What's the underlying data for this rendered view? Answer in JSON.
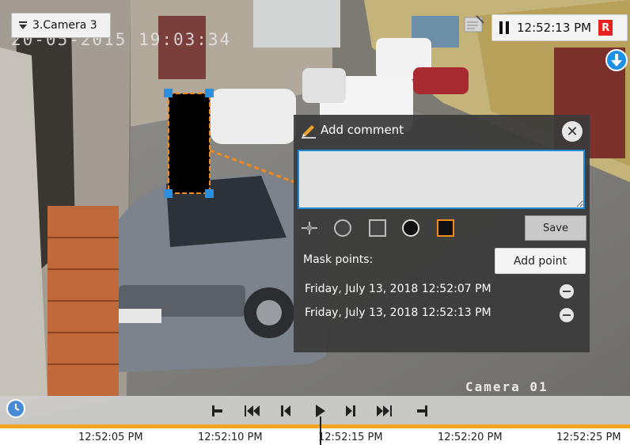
{
  "camera_selector": {
    "label": "3.Camera 3"
  },
  "overlay": {
    "osd_timestamp": "20-05-2015 19:03:34",
    "camera_watermark": "Camera 01"
  },
  "time_display": {
    "time": "12:52:13 PM",
    "record_badge": "R"
  },
  "comment_panel": {
    "title": "Add comment",
    "comment_value": "",
    "save_label": "Save",
    "mask_points_label": "Mask points:",
    "add_point_label": "Add point",
    "mask_points": [
      "Friday, July 13, 2018 12:52:07 PM",
      "Friday, July 13, 2018 12:52:13 PM"
    ],
    "shape_tools": [
      "crosshair",
      "circle",
      "square",
      "filled-circle",
      "filled-square"
    ]
  },
  "timeline": {
    "ticks": [
      "12:52:05 PM",
      "12:52:10 PM",
      "12:52:15 PM",
      "12:52:20 PM",
      "12:52:25 PM"
    ]
  },
  "colors": {
    "accent": "#1d8bd8",
    "record": "#e8231f",
    "timeline_bar": "#f5a623",
    "mask_outline": "#f28a1e"
  }
}
